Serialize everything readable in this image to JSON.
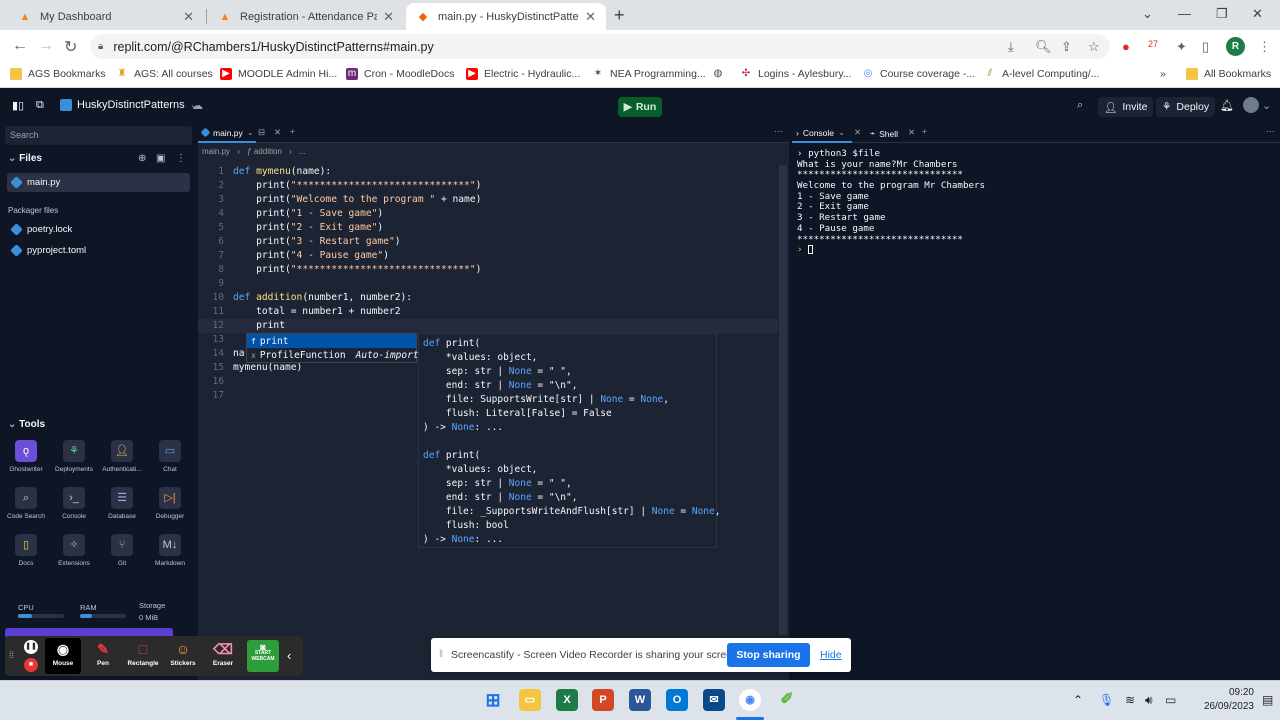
{
  "browser": {
    "tabs": [
      {
        "title": "My Dashboard",
        "icon": "moodle-icon"
      },
      {
        "title": "Registration - Attendance Page T",
        "icon": "moodle-icon"
      },
      {
        "title": "main.py - HuskyDistinctPatterns",
        "icon": "replit-icon",
        "active": true
      }
    ],
    "url": "replit.com/@RChambers1/HuskyDistinctPatterns#main.py",
    "profile_initial": "R",
    "extension_badge": "27",
    "bookmarks": [
      "AGS Bookmarks",
      "AGS: All courses",
      "MOODLE Admin Hi...",
      "Cron - MoodleDocs",
      "Electric - Hydraulic...",
      "NEA Programming...",
      "Logins - Aylesbury...",
      "Course coverage -...",
      "A-level Computing/..."
    ],
    "all_bookmarks": "All Bookmarks"
  },
  "replit": {
    "repl_name": "HuskyDistinctPatterns",
    "run_label": "Run",
    "invite_label": "Invite",
    "deploy_label": "Deploy",
    "sidebar": {
      "search_placeholder": "Search",
      "files_label": "Files",
      "files": [
        "main.py"
      ],
      "packager_label": "Packager files",
      "packager_files": [
        "poetry.lock",
        "pyproject.toml"
      ],
      "tools_label": "Tools",
      "tools": [
        "Ghostwriter",
        "Deployments",
        "Authenticati...",
        "Chat",
        "Code Search",
        "Console",
        "Database",
        "Debugger",
        "Docs",
        "Extensions",
        "Git",
        "Markdown"
      ],
      "usage": {
        "cpu": "CPU",
        "ram": "RAM",
        "storage": "Storage",
        "storage_value": "0 MiB"
      }
    },
    "editor": {
      "tab": "main.py",
      "breadcrumb_file": "main.py",
      "breadcrumb_symbol": "addition",
      "breadcrumb_more": "...",
      "lines": [
        "def mymenu(name):",
        "    print(\"******************************\")",
        "    print(\"Welcome to the program \" + name)",
        "    print(\"1 - Save game\")",
        "    print(\"2 - Exit game\")",
        "    print(\"3 - Restart game\")",
        "    print(\"4 - Pause game\")",
        "    print(\"******************************\")",
        "",
        "def addition(number1, number2):",
        "    total = number1 + number2",
        "    print",
        "",
        "na",
        "mymenu(name)",
        "",
        ""
      ],
      "autocomplete": [
        {
          "kind": "f",
          "label": "print",
          "detail": ""
        },
        {
          "kind": "x",
          "label": "ProfileFunction",
          "detail": "Auto-import"
        }
      ],
      "signature_popup": [
        "def print(",
        "    *values: object,",
        "    sep: str | None = \" \",",
        "    end: str | None = \"\\n\",",
        "    file: SupportsWrite[str] | None = None,",
        "    flush: Literal[False] = False",
        ") -> None: ...",
        "",
        "def print(",
        "    *values: object,",
        "    sep: str | None = \" \",",
        "    end: str | None = \"\\n\",",
        "    file: _SupportsWriteAndFlush[str] | None = None,",
        "    flush: bool",
        ") -> None: ..."
      ]
    },
    "console": {
      "tabs": [
        "Console",
        "Shell"
      ],
      "lines": [
        "python3 $file",
        "What is your name?Mr Chambers",
        "******************************",
        "Welcome to the program Mr Chambers",
        "1 - Save game",
        "2 - Exit game",
        "3 - Restart game",
        "4 - Pause game",
        "******************************"
      ],
      "prompt": "› "
    }
  },
  "screencastify": {
    "tools": [
      "Mouse",
      "Pen",
      "Rectangle",
      "Stickers",
      "Eraser",
      "START WEBCAM"
    ],
    "share_message": "Screencastify - Screen Video Recorder is sharing your screen.",
    "stop_label": "Stop sharing",
    "hide_label": "Hide"
  },
  "taskbar": {
    "time": "09:20",
    "date": "26/09/2023"
  }
}
